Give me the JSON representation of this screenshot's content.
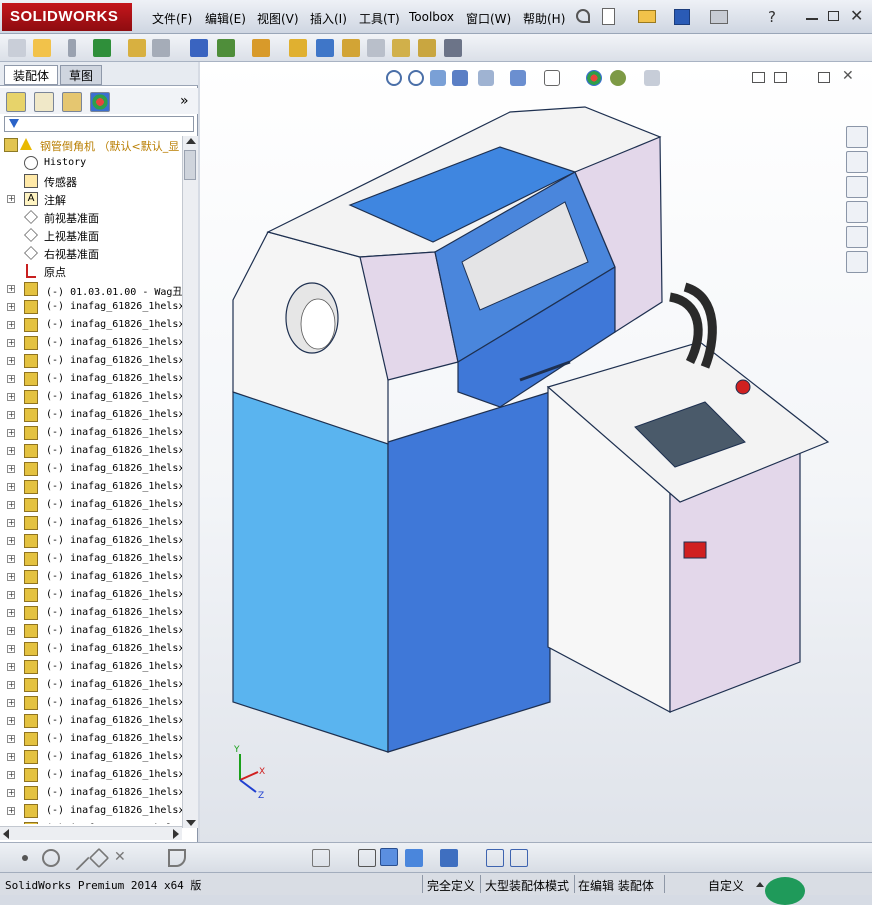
{
  "app": {
    "brand": "SOLIDWORKS"
  },
  "menu": [
    {
      "id": "file",
      "label": "文件(F)"
    },
    {
      "id": "edit",
      "label": "编辑(E)"
    },
    {
      "id": "view",
      "label": "视图(V)"
    },
    {
      "id": "insert",
      "label": "插入(I)"
    },
    {
      "id": "tools",
      "label": "工具(T)"
    },
    {
      "id": "toolbox",
      "label": "Toolbox"
    },
    {
      "id": "window",
      "label": "窗口(W)"
    },
    {
      "id": "help",
      "label": "帮助(H)"
    }
  ],
  "left_tabs": {
    "assembly": "装配体",
    "sketch": "草图"
  },
  "fm_more": "»",
  "tree": {
    "root": "钢管倒角机 （默认<默认_显",
    "history": "History",
    "sensors": "传感器",
    "annotations": "注解",
    "front_plane": "前视基准面",
    "top_plane": "上视基准面",
    "right_plane": "右视基准面",
    "origin": "原点",
    "first_part": "(-) 01.03.01.00 - Wag丑",
    "repeated_part": "(-) inafag_61826_1helsx",
    "repeated_count": 30
  },
  "status": {
    "product": "SolidWorks Premium 2014 x64 版",
    "defined": "完全定义",
    "mode": "大型装配体模式",
    "editing": "在编辑 装配体",
    "custom": "自定义"
  },
  "colors": {
    "accent_red": "#c4161c",
    "model_blue_dark": "#3f78d8",
    "model_blue_light": "#5ab4ef",
    "model_lilac": "#e3d7ea",
    "model_white": "#f7f7f7"
  },
  "triad": {
    "x": "X",
    "y": "Y",
    "z": "Z"
  }
}
